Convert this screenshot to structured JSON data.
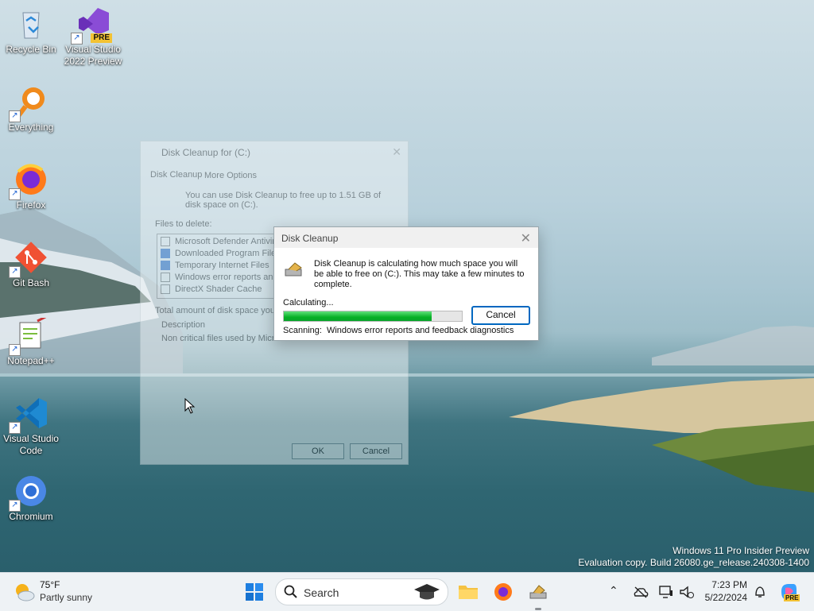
{
  "desktop": {
    "icons": [
      {
        "label": "Recycle Bin"
      },
      {
        "label": "Visual Studio 2022 Preview",
        "badge": "PRE"
      },
      {
        "label": "Everything"
      },
      {
        "label": "Firefox"
      },
      {
        "label": "Git Bash"
      },
      {
        "label": "Notepad++"
      },
      {
        "label": "Visual Studio Code"
      },
      {
        "label": "Chromium"
      }
    ],
    "watermark": {
      "line1": "Windows 11 Pro Insider Preview",
      "line2": "Evaluation copy. Build 26080.ge_release.240308-1400"
    }
  },
  "background_window": {
    "title": "Disk Cleanup for (C:)",
    "tabs": [
      "Disk Cleanup",
      "More Options"
    ],
    "intro": "You can use Disk Cleanup to free up to 1.51 GB of disk space on (C:).",
    "files_label": "Files to delete:",
    "files": [
      {
        "name": "Microsoft Defender Antivir...",
        "checked": false
      },
      {
        "name": "Downloaded Program Files",
        "checked": true
      },
      {
        "name": "Temporary Internet Files",
        "checked": true
      },
      {
        "name": "Windows error reports and",
        "checked": false
      },
      {
        "name": "DirectX Shader Cache",
        "checked": false
      }
    ],
    "total_label": "Total amount of disk space you...",
    "description_label": "Description",
    "description_text": "Non critical files used by Microsoft...",
    "ok_label": "OK",
    "cancel_label": "Cancel"
  },
  "dialog": {
    "title": "Disk Cleanup",
    "message": "Disk Cleanup is calculating how much space you will be able to free on  (C:). This may take a few minutes to complete.",
    "calculating_label": "Calculating...",
    "progress": 0.83,
    "cancel_label": "Cancel",
    "scanning_label": "Scanning:",
    "scanning_item": "Windows error reports and feedback diagnostics"
  },
  "taskbar": {
    "weather": {
      "temp": "75°F",
      "condition": "Partly sunny"
    },
    "search_placeholder": "Search",
    "clock": {
      "time": "7:23 PM",
      "date": "5/22/2024"
    },
    "copilot_badge": "PRE"
  },
  "colors": {
    "accent": "#0067c0",
    "progress": "#06b025",
    "taskbar_bg": "#eef2f5"
  }
}
